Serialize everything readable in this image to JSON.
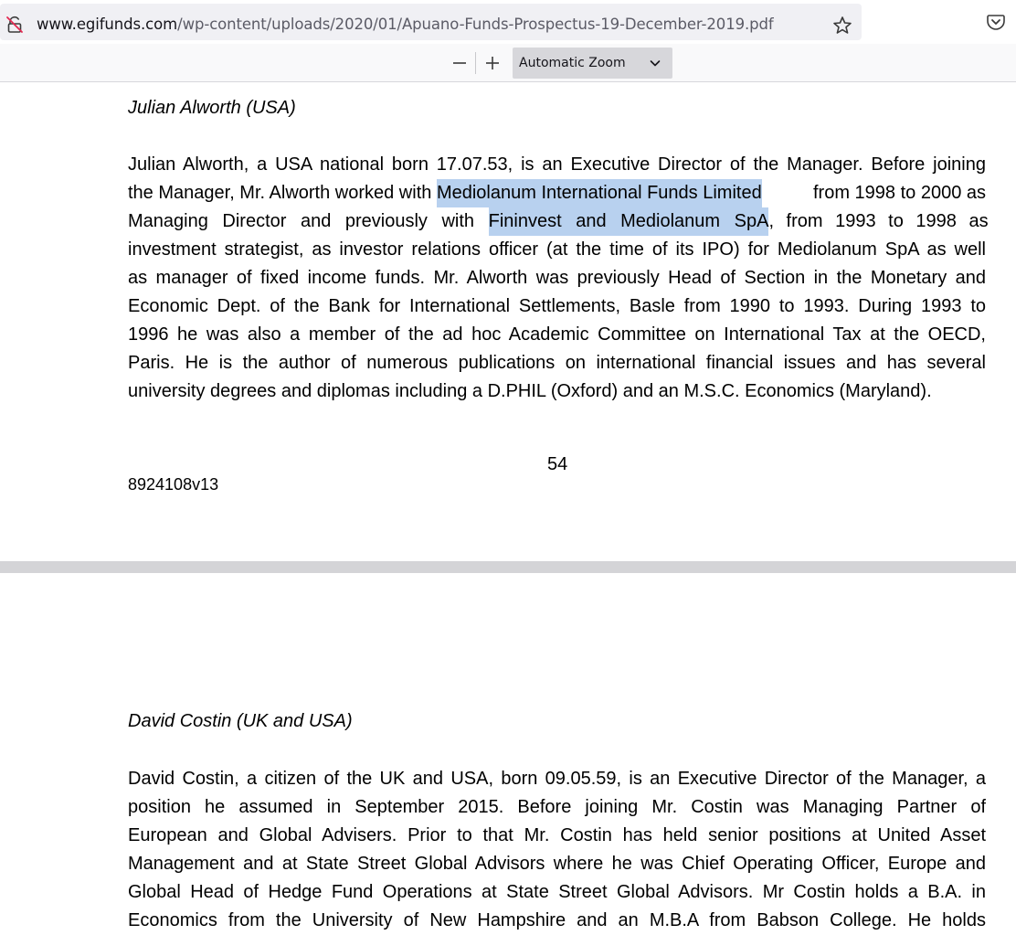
{
  "browser": {
    "url_host": "www.egifunds.com",
    "url_path": "/wp-content/uploads/2020/01/Apuano-Funds-Prospectus-19-December-2019.pdf",
    "icons": {
      "security": "lock-broken-icon",
      "bookmark": "star-icon",
      "pocket": "pocket-icon"
    }
  },
  "pdf_toolbar": {
    "zoom_out_label": "—",
    "zoom_in_label": "+",
    "zoom_value": "Automatic Zoom"
  },
  "page1": {
    "heading": "Julian Alworth (USA)",
    "paragraph": {
      "l1": "Julian Alworth, a USA national born 17.07.53, is an Executive Director of the Manager. Before joining",
      "l2_a": "the Manager, Mr. Alworth worked with ",
      "l2_hl": "Mediolanum International Funds Limited",
      "l2_b": " from 1998 to 2000 as",
      "l3_a": "Managing Director and previously with ",
      "l3_hl": "Fininvest and Mediolanum SpA",
      "l3_b": ", from 1993 to 1998 as",
      "l4": "investment strategist, as investor relations officer (at the time of its IPO) for Mediolanum SpA as well",
      "l5": "as manager of fixed income funds. Mr. Alworth was previously Head of Section in the Monetary and",
      "l6": "Economic Dept. of the Bank for International Settlements, Basle from 1990 to 1993. During 1993 to",
      "l7": "1996 he was also a member of the ad hoc Academic Committee on International Tax at the OECD,",
      "l8": "Paris. He is the author of numerous publications on international financial issues and has several",
      "l9": "university degrees and diplomas including a D.PHIL (Oxford) and an M.S.C. Economics (Maryland)."
    },
    "page_number": "54",
    "doc_id": "8924108v13"
  },
  "page2": {
    "heading": "David Costin (UK and USA)",
    "paragraph": {
      "l1": "David Costin, a citizen of the UK and USA, born 09.05.59, is an Executive Director of the Manager, a",
      "l2": "position he assumed in September 2015.  Before joining Mr. Costin was Managing Partner of",
      "l3": "European and Global Advisers.  Prior to that Mr. Costin has held senior positions at United Asset",
      "l4": "Management and at State Street Global Advisors where he was Chief Operating Officer, Europe and",
      "l5": "Global Head of Hedge Fund Operations at State Street Global Advisors. Mr Costin holds a B.A. in",
      "l6": "Economics from the University of New Hampshire and an M.B.A from Babson College. He holds"
    }
  },
  "colors": {
    "selection_highlight": "#b8d1ef",
    "page_gap": "#d4d4d7",
    "zoom_select_bg": "#d7d7db"
  }
}
